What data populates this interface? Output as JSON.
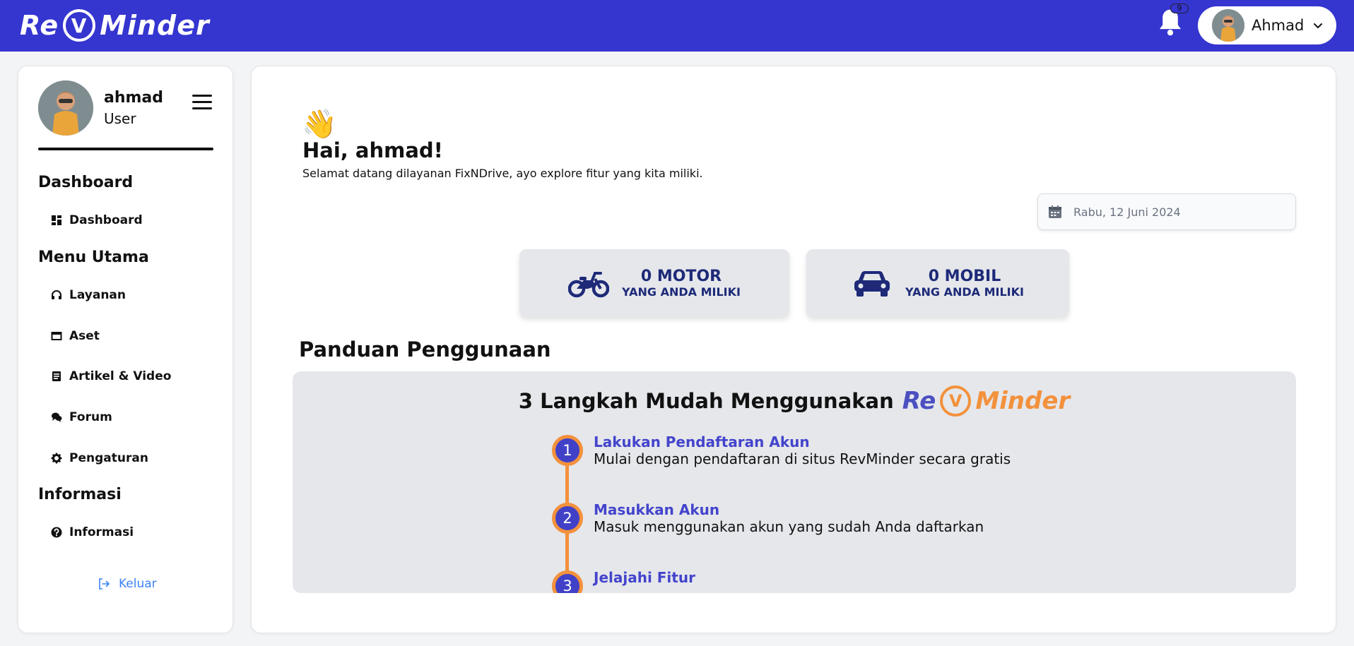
{
  "brand": {
    "logo_left": "Re",
    "logo_v": "V",
    "logo_right": "Minder"
  },
  "header": {
    "notification_count": "9",
    "user_name": "Ahmad"
  },
  "sidebar": {
    "username": "ahmad",
    "role": "User",
    "sections": {
      "dashboard": "Dashboard",
      "menu_utama": "Menu Utama",
      "informasi": "Informasi"
    },
    "items": {
      "dashboard": "Dashboard",
      "layanan": "Layanan",
      "aset": "Aset",
      "artikel": "Artikel & Video",
      "forum": "Forum",
      "pengaturan": "Pengaturan",
      "informasi": "Informasi"
    },
    "logout": "Keluar"
  },
  "main": {
    "wave": "👋",
    "greeting": "Hai, ahmad!",
    "subtitle": "Selamat datang dilayanan FixNDrive, ayo explore fitur yang kita miliki.",
    "date": "Rabu, 12 Juni 2024",
    "stats": {
      "motor_count": "0 MOTOR",
      "motor_label": "YANG ANDA MILIKI",
      "mobil_count": "0 MOBIL",
      "mobil_label": "YANG ANDA MILIKI"
    },
    "guide_title": "Panduan Penggunaan",
    "guide": {
      "heading": "3 Langkah Mudah Menggunakan",
      "steps": [
        {
          "num": "1",
          "title": "Lakukan Pendaftaran Akun",
          "desc": "Mulai dengan pendaftaran di situs RevMinder secara gratis"
        },
        {
          "num": "2",
          "title": "Masukkan Akun",
          "desc": "Masuk menggunakan akun yang sudah Anda daftarkan"
        },
        {
          "num": "3",
          "title": "Jelajahi Fitur",
          "desc": ""
        }
      ]
    }
  },
  "colors": {
    "topbar": "#3535d0",
    "accent_orange": "#f3913c",
    "stat_text": "#1e2a78",
    "link_blue": "#3b82f6"
  }
}
